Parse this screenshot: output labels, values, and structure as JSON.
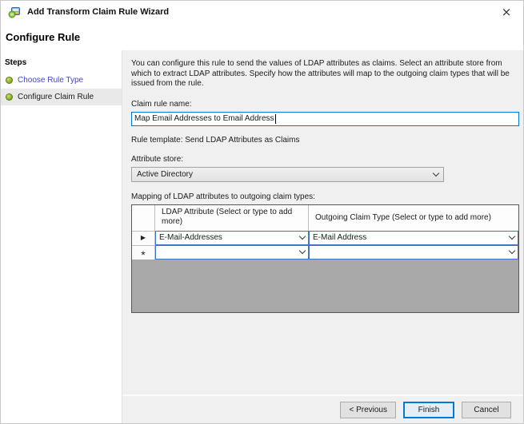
{
  "window": {
    "title": "Add Transform Claim Rule Wizard",
    "close_icon": "×"
  },
  "page": {
    "heading": "Configure Rule"
  },
  "sidebar": {
    "title": "Steps",
    "steps": [
      {
        "label": "Choose Rule Type",
        "state": "completed-link"
      },
      {
        "label": "Configure Claim Rule",
        "state": "current"
      }
    ]
  },
  "main": {
    "description": "You can configure this rule to send the values of LDAP attributes as claims. Select an attribute store from which to extract LDAP attributes. Specify how the attributes will map to the outgoing claim types that will be issued from the rule.",
    "claim_rule_name_label": "Claim rule name:",
    "claim_rule_name_value": "Map Email Addresses to Email Address",
    "rule_template": "Rule template: Send LDAP Attributes as Claims",
    "attribute_store_label": "Attribute store:",
    "attribute_store_value": "Active Directory",
    "mapping_label": "Mapping of LDAP attributes to outgoing claim types:",
    "table": {
      "col_headers": [
        "LDAP Attribute (Select or type to add more)",
        "Outgoing Claim Type (Select or type to add more)"
      ],
      "rows": [
        {
          "indicator_icon": "▶",
          "ldap_attribute": "E-Mail-Addresses",
          "outgoing_claim_type": "E-Mail Address"
        },
        {
          "indicator_icon": "*",
          "ldap_attribute": "",
          "outgoing_claim_type": ""
        }
      ]
    }
  },
  "footer": {
    "previous_label": "< Previous",
    "finish_label": "Finish",
    "cancel_label": "Cancel"
  },
  "colors": {
    "accent_focus_blue": "#0078d7",
    "grid_combo_border_blue": "#4472c4",
    "step_link_blue": "#4343d6",
    "step_dot_green": "#8db428",
    "panel_gray": "#f0f0f0",
    "grid_filler_gray": "#a8a8a8"
  }
}
